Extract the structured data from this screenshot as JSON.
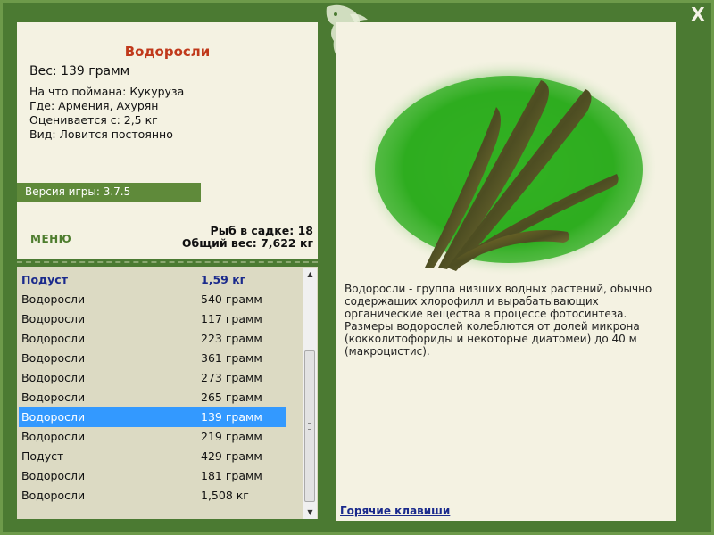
{
  "window": {
    "close_symbol": "X"
  },
  "fish": {
    "title": "Водоросли",
    "weight_line": "Вес: 139 грамм",
    "details": [
      "На что поймана: Кукуруза",
      "Где: Армения, Ахурян",
      "Оценивается с: 2,5 кг",
      "Вид: Ловится постоянно"
    ],
    "image_icon": "algae-image"
  },
  "version": "Версия игры: 3.7.5",
  "menu_label": "МЕНЮ",
  "stats": {
    "fish_in_keepnet": "Рыб в садке: 18",
    "total_weight": "Общий вес: 7,622 кг"
  },
  "catch_list": [
    {
      "name": "Подуст",
      "weight": "1,59 кг",
      "style": "header"
    },
    {
      "name": "Водоросли",
      "weight": "540 грамм",
      "style": ""
    },
    {
      "name": "Водоросли",
      "weight": "117 грамм",
      "style": ""
    },
    {
      "name": "Водоросли",
      "weight": "223 грамм",
      "style": ""
    },
    {
      "name": "Водоросли",
      "weight": "361 грамм",
      "style": ""
    },
    {
      "name": "Водоросли",
      "weight": "273 грамм",
      "style": ""
    },
    {
      "name": "Водоросли",
      "weight": "265 грамм",
      "style": ""
    },
    {
      "name": "Водоросли",
      "weight": "139 грамм",
      "style": "selected"
    },
    {
      "name": "Водоросли",
      "weight": "219 грамм",
      "style": ""
    },
    {
      "name": "Подуст",
      "weight": "429 грамм",
      "style": ""
    },
    {
      "name": "Водоросли",
      "weight": "181 грамм",
      "style": ""
    },
    {
      "name": "Водоросли",
      "weight": "1,508 кг",
      "style": ""
    }
  ],
  "description": "Водоросли - группа низших водных растений, обычно содержащих хлорофилл и вырабатывающих органические вещества в процессе фотосинтеза. Размеры водорослей колеблются от долей микрона (кокколитофориды и некоторые диатомеи) до 40 м (макроцистис).",
  "hotkeys_link": "Горячие клавиши",
  "colors": {
    "frame": "#4b7a32",
    "panel": "#f4f2e2",
    "list_bg": "#dcdac3",
    "title": "#c0391b",
    "selected": "#3399ff",
    "link": "#1a2a8c"
  }
}
